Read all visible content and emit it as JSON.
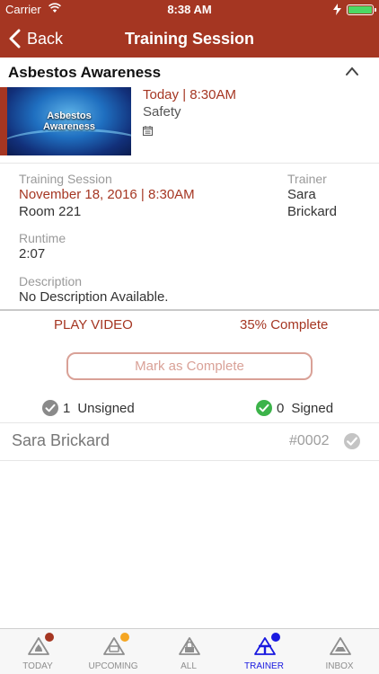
{
  "status_bar": {
    "carrier": "Carrier",
    "time": "8:38 AM"
  },
  "nav": {
    "back_label": "Back",
    "title": "Training Session"
  },
  "course": {
    "title": "Asbestos Awareness",
    "thumbnail_text_line1": "Asbestos",
    "thumbnail_text_line2": "Awareness",
    "when": "Today | 8:30AM",
    "category": "Safety"
  },
  "details": {
    "session_label": "Training Session",
    "session_date": "November 18, 2016 | 8:30AM",
    "room": "Room 221",
    "trainer_label": "Trainer",
    "trainer_first": "Sara",
    "trainer_last": "Brickard",
    "runtime_label": "Runtime",
    "runtime_value": "2:07",
    "description_label": "Description",
    "description_value": "No Description Available."
  },
  "actions": {
    "play_video": "PLAY VIDEO",
    "percent_complete_text": "35% Complete",
    "percent_complete": 35,
    "mark_complete": "Mark as Complete"
  },
  "signatures": {
    "unsigned_count": "1",
    "unsigned_label": "Unsigned",
    "signed_count": "0",
    "signed_label": "Signed"
  },
  "trainees": [
    {
      "name": "Sara Brickard",
      "number": "#0002"
    }
  ],
  "tabs": [
    {
      "label": "TODAY",
      "badge_color": "#a53622"
    },
    {
      "label": "UPCOMING",
      "badge_color": "#f5a623"
    },
    {
      "label": "ALL"
    },
    {
      "label": "TRAINER",
      "badge_color": "#1a1ae0",
      "active": true
    },
    {
      "label": "INBOX"
    }
  ],
  "colors": {
    "brand": "#a53622",
    "active_tab": "#1a1ae0",
    "signed_green": "#3cb34a"
  }
}
